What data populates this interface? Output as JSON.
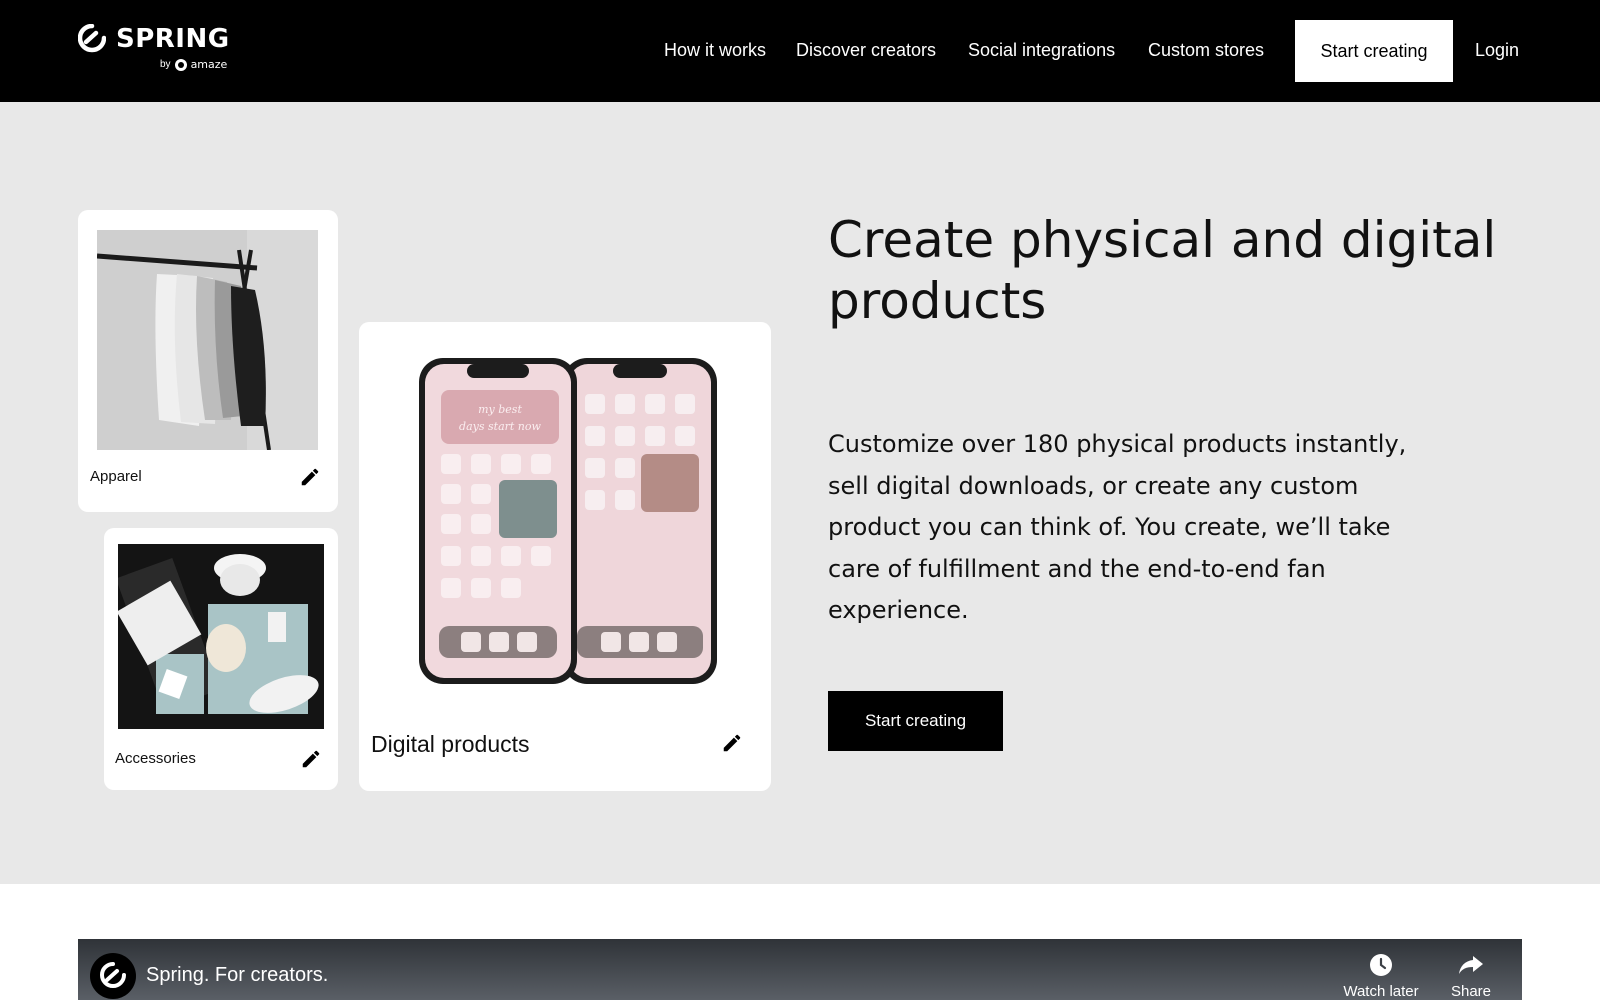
{
  "header": {
    "logo_word": "SPRING",
    "logo_by": "by",
    "logo_brand": "amaze",
    "nav": [
      "How it works",
      "Discover creators",
      "Social integrations",
      "Custom stores"
    ],
    "cta": "Start creating",
    "login": "Login"
  },
  "hero": {
    "title": "Create physical and digital products",
    "description": "Customize over 180 physical products instantly, sell digital downloads, or create any custom product you can think of. You create, we’ll take care of fulfillment and the end-to-end fan experience.",
    "cta": "Start creating",
    "cards": [
      {
        "label": "Apparel",
        "icon": "pencil-icon"
      },
      {
        "label": "Accessories",
        "icon": "pencil-icon"
      },
      {
        "label": "Digital products",
        "icon": "pencil-icon"
      }
    ],
    "phone_text": [
      "my best",
      "days start now"
    ]
  },
  "video": {
    "title": "Spring. For creators.",
    "actions": [
      {
        "label": "Watch later",
        "icon": "clock-icon"
      },
      {
        "label": "Share",
        "icon": "share-icon"
      }
    ]
  },
  "colors": {
    "header_bg": "#000000",
    "hero_bg": "#e8e8e8",
    "accent": "#000000",
    "phone_pink": "#e9c9cf"
  }
}
